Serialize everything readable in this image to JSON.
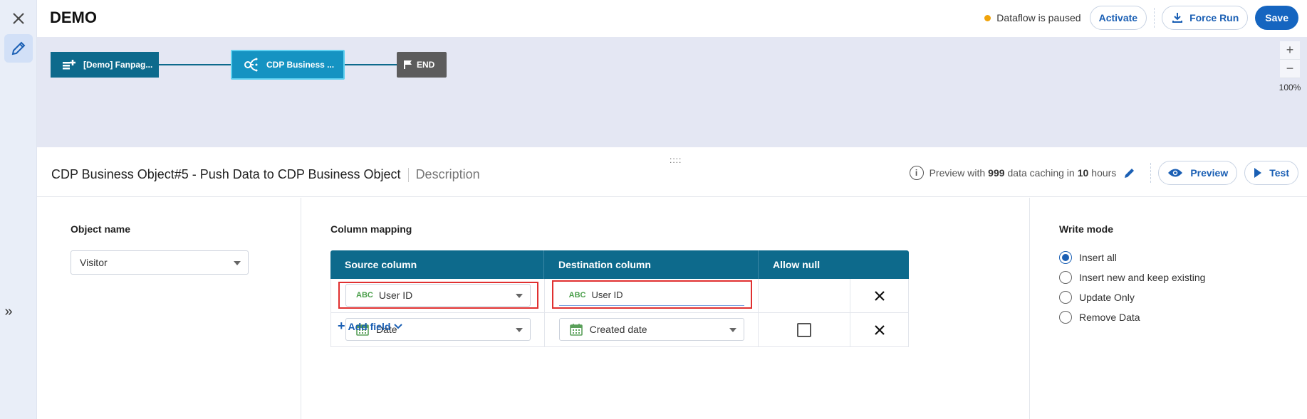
{
  "header": {
    "title": "DEMO",
    "status_text": "Dataflow is paused",
    "status_color": "#f0a30a",
    "activate_label": "Activate",
    "force_run_label": "Force Run",
    "save_label": "Save"
  },
  "canvas": {
    "nodes": [
      {
        "label": "[Demo] Fanpag...",
        "icon": "source-add-icon"
      },
      {
        "label": "CDP Business ...",
        "icon": "cdp-flow-icon"
      },
      {
        "label": "END",
        "icon": "flag-icon"
      }
    ],
    "zoom_in": "+",
    "zoom_out": "−",
    "zoom_level": "100%"
  },
  "details": {
    "title": "CDP Business Object#5 - Push Data to CDP Business Object",
    "description": "Description",
    "preview_prefix": "Preview with",
    "preview_count": "999",
    "preview_mid": "data caching in",
    "preview_hours": "10",
    "preview_suffix": "hours",
    "preview_button": "Preview",
    "test_button": "Test"
  },
  "object": {
    "label": "Object name",
    "value": "Visitor"
  },
  "mapping": {
    "label": "Column mapping",
    "headers": {
      "source": "Source column",
      "destination": "Destination column",
      "allow_null": "Allow null"
    },
    "rows": [
      {
        "source_type": "ABC",
        "source": "User ID",
        "dest_type": "ABC",
        "dest": "User ID"
      },
      {
        "source_type": "date",
        "source": "Date",
        "dest_type": "date",
        "dest": "Created date",
        "allow_null": false
      }
    ],
    "add_field": "Add field"
  },
  "write_mode": {
    "label": "Write mode",
    "options": [
      "Insert all",
      "Insert new and keep existing",
      "Update Only",
      "Remove Data"
    ],
    "selected": "Insert all"
  }
}
